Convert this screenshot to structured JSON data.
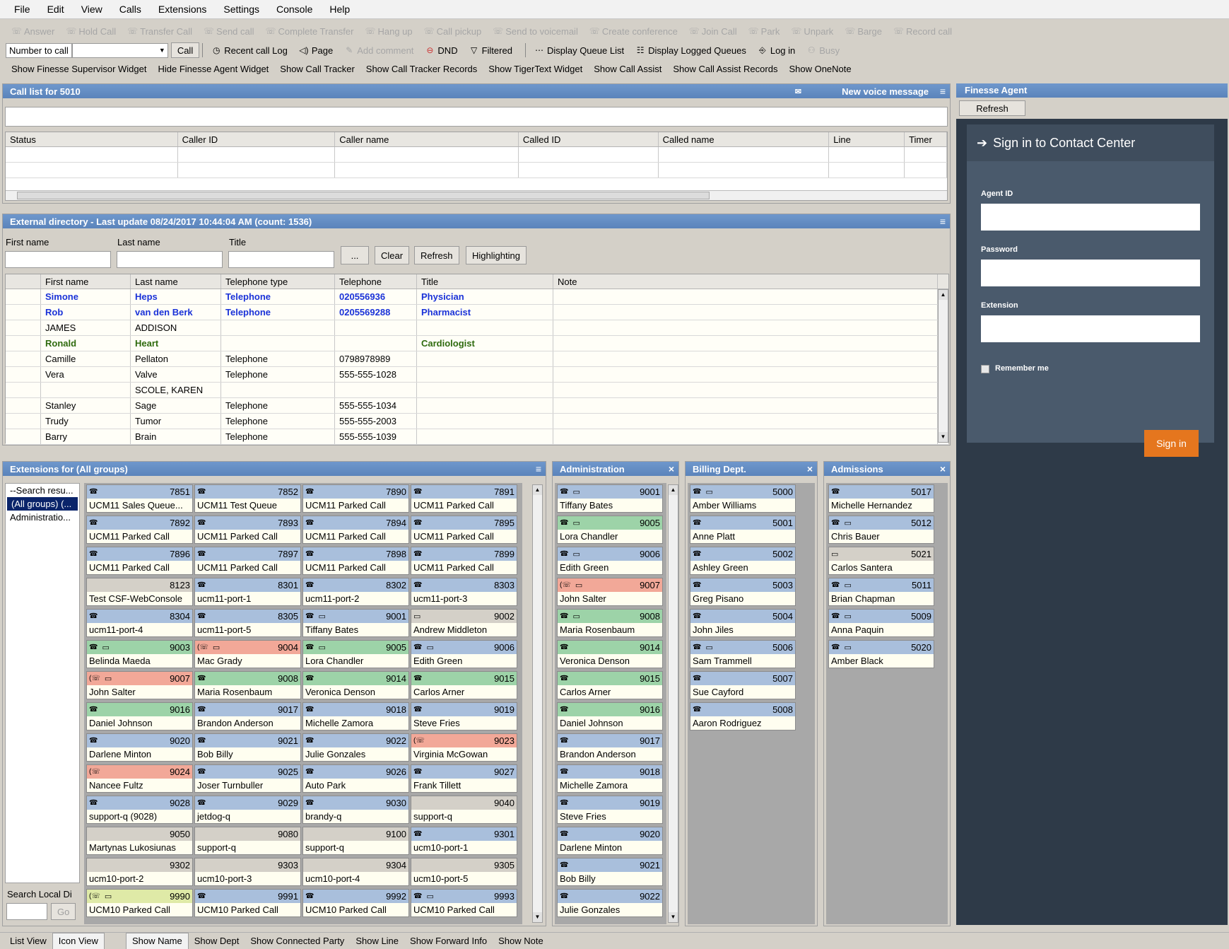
{
  "menu": [
    "File",
    "Edit",
    "View",
    "Calls",
    "Extensions",
    "Settings",
    "Console",
    "Help"
  ],
  "toolbar1": [
    {
      "label": "Answer",
      "icon": "answer-icon"
    },
    {
      "label": "Hold Call",
      "icon": "hold-icon"
    },
    {
      "label": "Transfer Call",
      "icon": "transfer-icon"
    },
    {
      "label": "Send call",
      "icon": "send-icon"
    },
    {
      "label": "Complete Transfer",
      "icon": "complete-transfer-icon"
    },
    {
      "label": "Hang up",
      "icon": "hangup-icon"
    },
    {
      "label": "Call pickup",
      "icon": "pickup-icon"
    },
    {
      "label": "Send to voicemail",
      "icon": "voicemail-icon"
    },
    {
      "label": "Create conference",
      "icon": "conference-icon"
    },
    {
      "label": "Join Call",
      "icon": "join-icon"
    },
    {
      "label": "Park",
      "icon": "park-icon"
    },
    {
      "label": "Unpark",
      "icon": "unpark-icon"
    },
    {
      "label": "Barge",
      "icon": "barge-icon"
    },
    {
      "label": "Record call",
      "icon": "record-icon"
    }
  ],
  "toolbar2": {
    "number_label": "Number to call",
    "call_btn": "Call",
    "recent": "Recent call Log",
    "page": "Page",
    "add_comment": "Add comment",
    "dnd": "DND",
    "filtered": "Filtered",
    "queue_list": "Display Queue List",
    "logged_queues": "Display Logged Queues",
    "login": "Log in",
    "busy": "Busy"
  },
  "toolbar3": [
    "Show Finesse Supervisor Widget",
    "Hide Finesse Agent Widget",
    "Show Call Tracker",
    "Show Call Tracker Records",
    "Show TigerText Widget",
    "Show Call Assist",
    "Show Call Assist Records",
    "Show OneNote"
  ],
  "calllist": {
    "title": "Call list for 5010",
    "voice": "New voice message",
    "columns": [
      "Status",
      "Caller ID",
      "Caller name",
      "Called ID",
      "Called name",
      "Line",
      "Timer"
    ]
  },
  "directory": {
    "title": "External directory - Last update 08/24/2017 10:44:04 AM (count: 1536)",
    "labels": [
      "First name",
      "Last name",
      "Title"
    ],
    "more": "...",
    "clear": "Clear",
    "refresh": "Refresh",
    "highlighting": "Highlighting",
    "columns": [
      "First name",
      "Last name",
      "Telephone type",
      "Telephone",
      "Title",
      "Note"
    ],
    "rows": [
      {
        "c": [
          "Simone",
          "Heps",
          "Telephone",
          "020556936",
          "Physician",
          ""
        ],
        "s": "blue"
      },
      {
        "c": [
          "Rob",
          "van den Berk",
          "Telephone",
          "0205569288",
          "Pharmacist",
          ""
        ],
        "s": "blue"
      },
      {
        "c": [
          "JAMES",
          "ADDISON",
          "",
          "",
          "",
          ""
        ],
        "s": ""
      },
      {
        "c": [
          "Ronald",
          "Heart",
          "",
          "",
          "Cardiologist",
          ""
        ],
        "s": "green"
      },
      {
        "c": [
          "Camille",
          "Pellaton",
          "Telephone",
          "0798978989",
          "",
          ""
        ],
        "s": ""
      },
      {
        "c": [
          "Vera",
          "Valve",
          "Telephone",
          "555-555-1028",
          "",
          ""
        ],
        "s": ""
      },
      {
        "c": [
          "",
          "SCOLE, KAREN",
          "",
          "",
          "",
          ""
        ],
        "s": ""
      },
      {
        "c": [
          "Stanley",
          "Sage",
          "Telephone",
          "555-555-1034",
          "",
          ""
        ],
        "s": ""
      },
      {
        "c": [
          "Trudy",
          "Tumor",
          "Telephone",
          "555-555-2003",
          "",
          ""
        ],
        "s": ""
      },
      {
        "c": [
          "Barry",
          "Brain",
          "Telephone",
          "555-555-1039",
          "",
          ""
        ],
        "s": ""
      }
    ]
  },
  "extensions": {
    "title": "Extensions for (All groups)",
    "groups": [
      "--Search resu...",
      "(All groups) (...",
      "Administratio..."
    ],
    "search_label": "Search Local Di",
    "go": "Go",
    "tiles": [
      [
        "7851",
        "UCM11 Sales Queue...",
        "blue",
        0
      ],
      [
        "7852",
        "UCM11 Test Queue",
        "blue",
        0
      ],
      [
        "7890",
        "UCM11 Parked Call",
        "blue",
        0
      ],
      [
        "7891",
        "UCM11 Parked Call",
        "blue",
        0
      ],
      [
        "7892",
        "UCM11 Parked Call",
        "blue",
        0
      ],
      [
        "7893",
        "UCM11 Parked Call",
        "blue",
        0
      ],
      [
        "7894",
        "UCM11 Parked Call",
        "blue",
        0
      ],
      [
        "7895",
        "UCM11 Parked Call",
        "blue",
        0
      ],
      [
        "7896",
        "UCM11 Parked Call",
        "blue",
        0
      ],
      [
        "7897",
        "UCM11 Parked Call",
        "blue",
        0
      ],
      [
        "7898",
        "UCM11 Parked Call",
        "blue",
        0
      ],
      [
        "7899",
        "UCM11 Parked Call",
        "blue",
        0
      ],
      [
        "8123",
        "Test CSF-WebConsole",
        "gray",
        0
      ],
      [
        "8301",
        "ucm11-port-1",
        "blue",
        0
      ],
      [
        "8302",
        "ucm11-port-2",
        "blue",
        0
      ],
      [
        "8303",
        "ucm11-port-3",
        "blue",
        0
      ],
      [
        "8304",
        "ucm11-port-4",
        "blue",
        0
      ],
      [
        "8305",
        "ucm11-port-5",
        "blue",
        0
      ],
      [
        "9001",
        "Tiffany Bates",
        "blue",
        1
      ],
      [
        "9002",
        "Andrew Middleton",
        "gray",
        1
      ],
      [
        "9003",
        "Belinda Maeda",
        "green",
        1
      ],
      [
        "9004",
        "Mac Grady",
        "red",
        1
      ],
      [
        "9005",
        "Lora Chandler",
        "green",
        1
      ],
      [
        "9006",
        "Edith Green",
        "blue",
        1
      ],
      [
        "9007",
        "John Salter",
        "red",
        1
      ],
      [
        "9008",
        "Maria Rosenbaum",
        "green",
        0
      ],
      [
        "9014",
        "Veronica Denson",
        "green",
        0
      ],
      [
        "9015",
        "Carlos Arner",
        "green",
        0
      ],
      [
        "9016",
        "Daniel Johnson",
        "green",
        0
      ],
      [
        "9017",
        "Brandon Anderson",
        "blue",
        0
      ],
      [
        "9018",
        "Michelle Zamora",
        "blue",
        0
      ],
      [
        "9019",
        "Steve Fries",
        "blue",
        0
      ],
      [
        "9020",
        "Darlene Minton",
        "blue",
        0
      ],
      [
        "9021",
        "Bob Billy",
        "blue",
        0
      ],
      [
        "9022",
        "Julie Gonzales",
        "blue",
        0
      ],
      [
        "9023",
        "Virginia McGowan",
        "red",
        0
      ],
      [
        "9024",
        "Nancee Fultz",
        "red",
        0
      ],
      [
        "9025",
        "Joser Turnbuller",
        "blue",
        0
      ],
      [
        "9026",
        "Auto Park",
        "blue",
        0
      ],
      [
        "9027",
        "Frank Tillett",
        "blue",
        0
      ],
      [
        "9028",
        "support-q (9028)",
        "blue",
        0
      ],
      [
        "9029",
        "jetdog-q",
        "blue",
        0
      ],
      [
        "9030",
        "brandy-q",
        "blue",
        0
      ],
      [
        "9040",
        "support-q",
        "gray",
        0
      ],
      [
        "9050",
        "Martynas Lukosiunas",
        "gray",
        0
      ],
      [
        "9080",
        "support-q",
        "gray",
        0
      ],
      [
        "9100",
        "support-q",
        "gray",
        0
      ],
      [
        "9301",
        "ucm10-port-1",
        "blue",
        0
      ],
      [
        "9302",
        "ucm10-port-2",
        "gray",
        0
      ],
      [
        "9303",
        "ucm10-port-3",
        "gray",
        0
      ],
      [
        "9304",
        "ucm10-port-4",
        "gray",
        0
      ],
      [
        "9305",
        "ucm10-port-5",
        "gray",
        0
      ],
      [
        "9990",
        "UCM10 Parked Call",
        "yellow",
        1
      ],
      [
        "9991",
        "UCM10 Parked Call",
        "blue",
        0
      ],
      [
        "9992",
        "UCM10 Parked Call",
        "blue",
        0
      ],
      [
        "9993",
        "UCM10 Parked Call",
        "blue",
        1
      ]
    ]
  },
  "administration": {
    "title": "Administration",
    "tiles": [
      [
        "9001",
        "Tiffany Bates",
        "blue",
        1
      ],
      [
        "9005",
        "Lora Chandler",
        "green",
        1
      ],
      [
        "9006",
        "Edith Green",
        "blue",
        1
      ],
      [
        "9007",
        "John Salter",
        "red",
        1
      ],
      [
        "9008",
        "Maria Rosenbaum",
        "green",
        1
      ],
      [
        "9014",
        "Veronica Denson",
        "green",
        0
      ],
      [
        "9015",
        "Carlos Arner",
        "green",
        0
      ],
      [
        "9016",
        "Daniel Johnson",
        "green",
        0
      ],
      [
        "9017",
        "Brandon Anderson",
        "blue",
        0
      ],
      [
        "9018",
        "Michelle Zamora",
        "blue",
        0
      ],
      [
        "9019",
        "Steve Fries",
        "blue",
        0
      ],
      [
        "9020",
        "Darlene Minton",
        "blue",
        0
      ],
      [
        "9021",
        "Bob Billy",
        "blue",
        0
      ],
      [
        "9022",
        "Julie Gonzales",
        "blue",
        0
      ]
    ]
  },
  "billing": {
    "title": "Billing Dept.",
    "tiles": [
      [
        "5000",
        "Amber Williams",
        "blue",
        1
      ],
      [
        "5001",
        "Anne Platt",
        "blue",
        0
      ],
      [
        "5002",
        "Ashley Green",
        "blue",
        0
      ],
      [
        "5003",
        "Greg Pisano",
        "blue",
        0
      ],
      [
        "5004",
        "John Jiles",
        "blue",
        0
      ],
      [
        "5006",
        "Sam Trammell",
        "blue",
        1
      ],
      [
        "5007",
        "Sue Cayford",
        "blue",
        0
      ],
      [
        "5008",
        "Aaron Rodriguez",
        "blue",
        0
      ]
    ]
  },
  "admissions": {
    "title": "Admissions",
    "tiles": [
      [
        "5017",
        "Michelle Hernandez",
        "blue",
        0
      ],
      [
        "5012",
        "Chris Bauer",
        "blue",
        1
      ],
      [
        "5021",
        "Carlos Santera",
        "gray",
        1
      ],
      [
        "5011",
        "Brian Chapman",
        "blue",
        1
      ],
      [
        "5009",
        "Anna Paquin",
        "blue",
        1
      ],
      [
        "5020",
        "Amber Black",
        "blue",
        1
      ]
    ]
  },
  "finesse": {
    "title": "Finesse Agent",
    "refresh": "Refresh",
    "heading": "Sign in to Contact Center",
    "agent_id": "Agent ID",
    "password": "Password",
    "extension": "Extension",
    "remember": "Remember me",
    "signin": "Sign in"
  },
  "statusbar": [
    "List View",
    "Icon View",
    "Show Name",
    "Show Dept",
    "Show Connected Party",
    "Show Line",
    "Show Forward Info",
    "Show Note"
  ]
}
